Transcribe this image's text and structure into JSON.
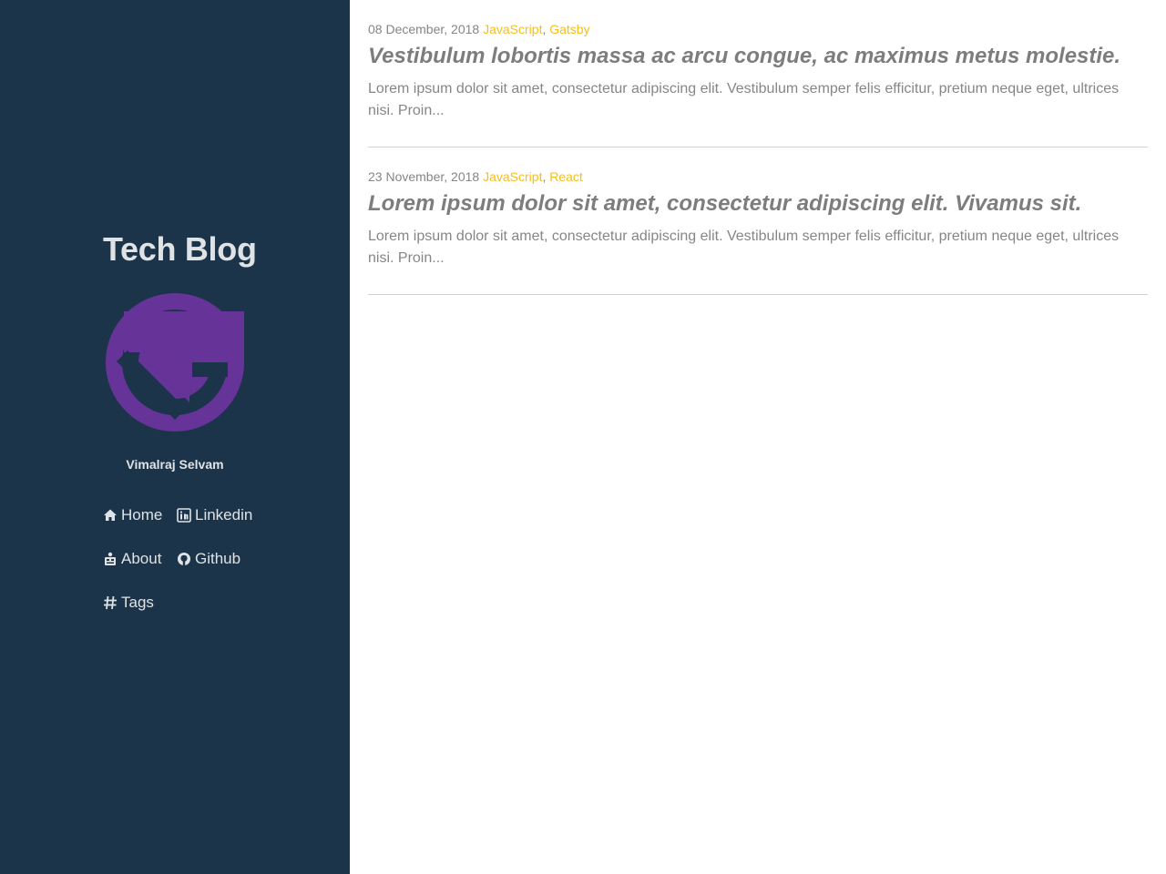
{
  "sidebar": {
    "title": "Tech Blog",
    "author": "Vimalraj Selvam",
    "logo_icon": "gatsby-logo",
    "logo_color": "#663399",
    "background": "#1b3449",
    "nav": [
      {
        "label": "Home",
        "icon": "home-icon"
      },
      {
        "label": "Linkedin",
        "icon": "linkedin-icon"
      },
      {
        "label": "About",
        "icon": "about-icon"
      },
      {
        "label": "Github",
        "icon": "github-icon"
      },
      {
        "label": "Tags",
        "icon": "hash-icon"
      }
    ]
  },
  "posts": [
    {
      "date": "08 December, 2018",
      "tags": [
        "JavaScript",
        "Gatsby"
      ],
      "separator": ",",
      "title": "Vestibulum lobortis massa ac arcu congue, ac maximus metus molestie.",
      "excerpt": "Lorem ipsum dolor sit amet, consectetur adipiscing elit. Vestibulum semper felis efficitur, pretium neque eget, ultrices nisi. Proin..."
    },
    {
      "date": "23 November, 2018",
      "tags": [
        "JavaScript",
        "React"
      ],
      "separator": ",",
      "title": "Lorem ipsum dolor sit amet, consectetur adipiscing elit. Vivamus sit.",
      "excerpt": "Lorem ipsum dolor sit amet, consectetur adipiscing elit. Vestibulum semper felis efficitur, pretium neque eget, ultrices nisi. Proin..."
    }
  ],
  "colors": {
    "tag": "#f7bf16",
    "text_muted": "#868686",
    "sidebar_text": "#dfe3e6"
  }
}
